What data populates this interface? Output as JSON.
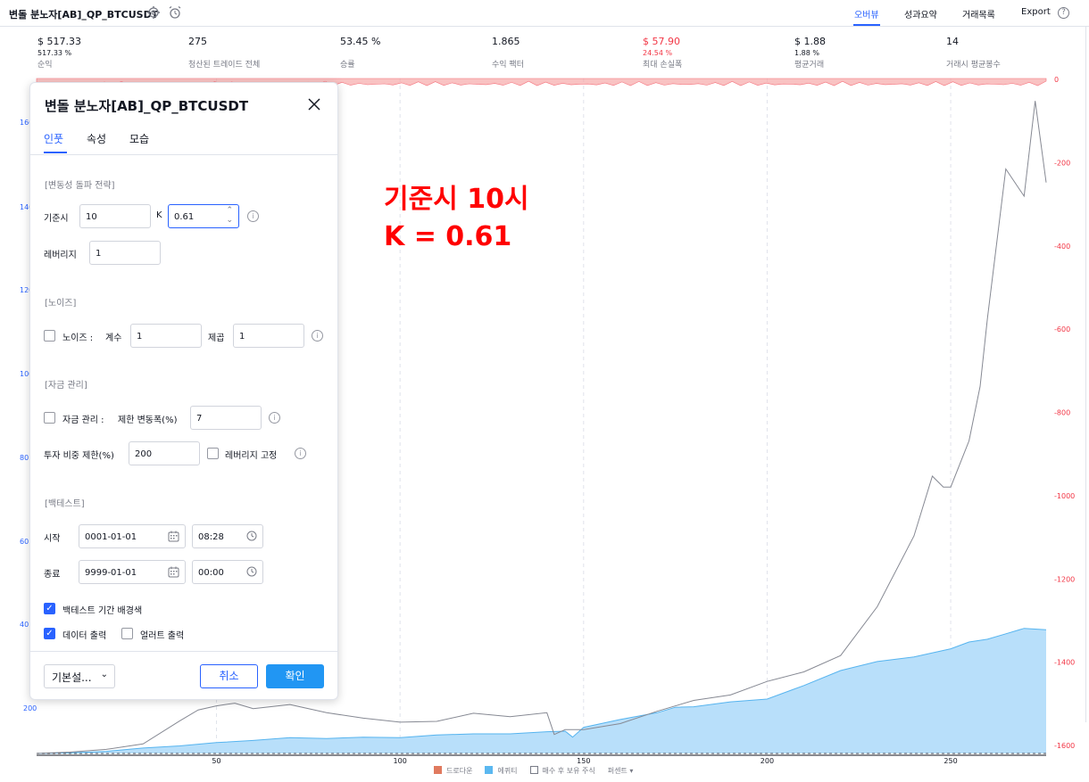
{
  "topbar": {
    "title": "변돌 분노자[AB]_QP_BTCUSDT",
    "tabs": [
      "오버뷰",
      "성과요약",
      "거래목록",
      "Export"
    ],
    "help": "?"
  },
  "stats": [
    {
      "value": "$ 517.33",
      "percent": "517.33 %",
      "label": "순익",
      "red": false
    },
    {
      "value": "275",
      "percent": "",
      "label": "청산된 트레이드 전체",
      "red": false
    },
    {
      "value": "53.45 %",
      "percent": "",
      "label": "승률",
      "red": false
    },
    {
      "value": "1.865",
      "percent": "",
      "label": "수익 팩터",
      "red": false
    },
    {
      "value": "$ 57.90",
      "percent": "24.54 %",
      "label": "최대 손실폭",
      "red": true
    },
    {
      "value": "$ 1.88",
      "percent": "1.88 %",
      "label": "평균거래",
      "red": false
    },
    {
      "value": "14",
      "percent": "",
      "label": "거래시 평균봉수",
      "red": false
    }
  ],
  "chart_data": {
    "type": "area",
    "x_ticks": [
      "50",
      "100",
      "150",
      "200",
      "250"
    ],
    "x_tick_values": [
      50,
      100,
      150,
      200,
      250
    ],
    "xlim": [
      1,
      276
    ],
    "left_axis_ticks": [
      "160",
      "140",
      "120",
      "100",
      "80",
      "60",
      "40",
      "200"
    ],
    "right_axis_ticks": [
      "0",
      "-200",
      "-400",
      "-600",
      "-800",
      "-1000",
      "-1200",
      "-1400",
      "-1600"
    ],
    "right_axis_values": [
      0,
      -200,
      -400,
      -600,
      -800,
      -1000,
      -1200,
      -1400,
      -1600
    ],
    "legend": [
      "드로다운",
      "에퀴티",
      "매수 후 보유 주식",
      "퍼센트 ▾"
    ],
    "series": [
      {
        "name": "에퀴티",
        "color": "#b8dffa",
        "stroke": "#56b4ef",
        "x": [
          1,
          10,
          20,
          30,
          40,
          50,
          60,
          70,
          80,
          90,
          100,
          110,
          120,
          130,
          140,
          145,
          147,
          150,
          160,
          170,
          175,
          180,
          190,
          200,
          210,
          220,
          230,
          240,
          250,
          255,
          260,
          265,
          270,
          276
        ],
        "values": [
          0,
          2,
          8,
          20,
          28,
          40,
          48,
          58,
          55,
          60,
          58,
          68,
          72,
          72,
          80,
          82,
          60,
          96,
          125,
          150,
          170,
          172,
          190,
          200,
          250,
          305,
          338,
          355,
          385,
          410,
          420,
          440,
          460,
          455
        ]
      },
      {
        "name": "매수 후 보유 주식",
        "color": "#868993",
        "x": [
          1,
          10,
          20,
          30,
          40,
          45,
          50,
          55,
          60,
          70,
          80,
          90,
          100,
          110,
          120,
          130,
          140,
          142,
          145,
          150,
          160,
          170,
          180,
          190,
          200,
          210,
          220,
          230,
          240,
          245,
          248,
          250,
          255,
          258,
          260,
          265,
          270,
          273,
          276
        ],
        "values": [
          0,
          5,
          15,
          35,
          120,
          160,
          175,
          185,
          165,
          180,
          150,
          130,
          115,
          118,
          148,
          135,
          150,
          70,
          88,
          88,
          110,
          155,
          195,
          215,
          265,
          300,
          360,
          540,
          800,
          1020,
          980,
          980,
          1150,
          1350,
          1600,
          2150,
          2050,
          2400,
          2100
        ]
      },
      {
        "name": "드로다운",
        "color": "#f7a9a9",
        "x": [
          1,
          276
        ],
        "values": [
          0,
          0
        ]
      }
    ]
  },
  "annotation": {
    "line1": "기준시 10시",
    "line2": "K = 0.61"
  },
  "dialog": {
    "title": "변돌 분노자[AB]_QP_BTCUSDT",
    "tabs": [
      "인풋",
      "속성",
      "모습"
    ],
    "sections": {
      "volatility": "[변동성 돌파 전략]",
      "noise": "[노이즈]",
      "money": "[자금 관리]",
      "backtest": "[백테스트]"
    },
    "base_hour_label": "기준시",
    "base_hour_value": "10",
    "k_label": "K",
    "k_value": "0.61",
    "leverage_label": "레버리지",
    "leverage_value": "1",
    "noise_label": "노이즈 :",
    "noise_coef_label": "계수",
    "noise_coef_value": "1",
    "noise_pow_label": "제곱",
    "noise_pow_value": "1",
    "money_label": "자금 관리 :",
    "money_limit_label": "제한 변동폭(%)",
    "money_limit_value": "7",
    "invest_label": "투자 비중 제한(%)",
    "invest_value": "200",
    "leverage_fix_label": "레버리지 고정",
    "start_label": "시작",
    "start_date": "0001-01-01",
    "start_time": "08:28",
    "end_label": "종료",
    "end_date": "9999-01-01",
    "end_time": "00:00",
    "bg_color_label": "백테스트 기간 배경색",
    "data_out_label": "데이터 출력",
    "alert_out_label": "얼러트 출력",
    "preset_label": "기본설...",
    "cancel_label": "취소",
    "ok_label": "확인"
  }
}
